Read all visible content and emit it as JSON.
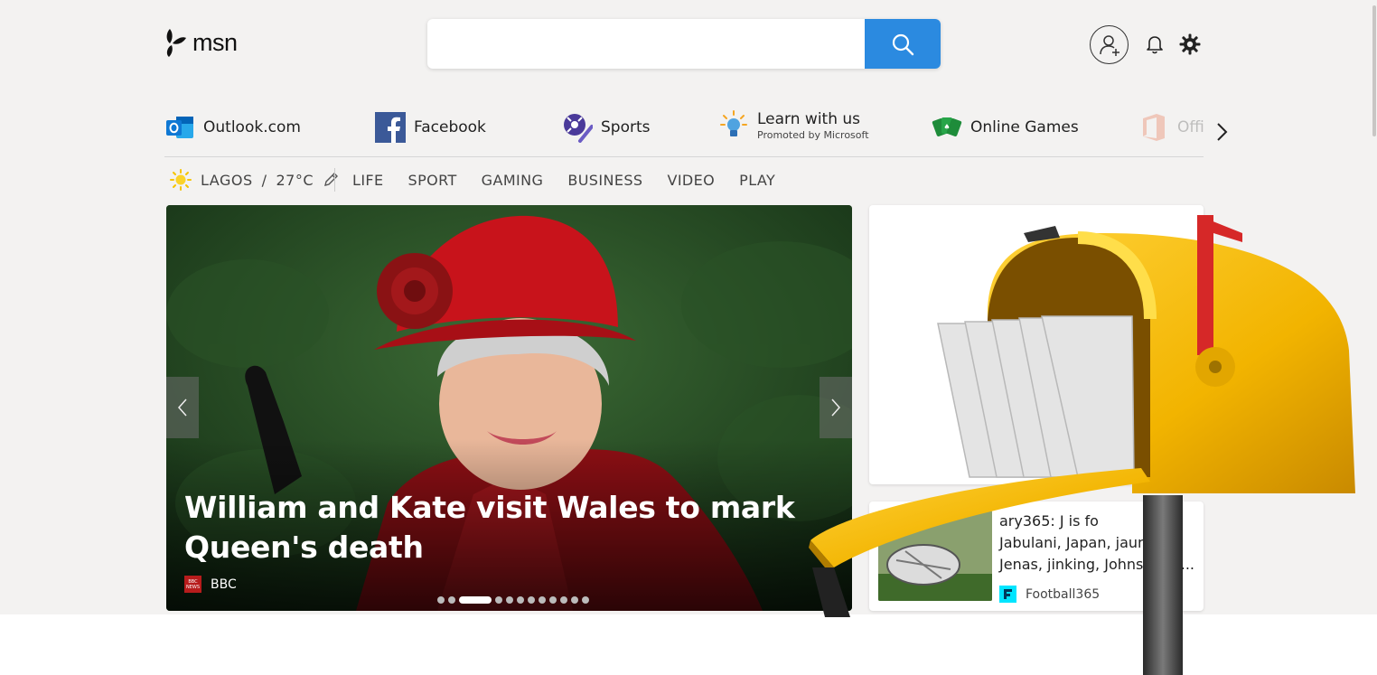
{
  "header": {
    "logo_text": "msn",
    "search": {
      "value": "",
      "placeholder": ""
    }
  },
  "quick_links": [
    {
      "label": "Outlook.com",
      "icon": "outlook-icon",
      "sub": ""
    },
    {
      "label": "Facebook",
      "icon": "facebook-icon",
      "sub": ""
    },
    {
      "label": "Sports",
      "icon": "sports-icon",
      "sub": ""
    },
    {
      "label": "Learn with us",
      "icon": "lightbulb-icon",
      "sub": "Promoted by Microsoft"
    },
    {
      "label": "Online Games",
      "icon": "cards-icon",
      "sub": ""
    },
    {
      "label": "Offi",
      "icon": "office-icon",
      "sub": ""
    }
  ],
  "weather": {
    "location": "LAGOS",
    "temp": "27°C"
  },
  "nav": [
    "LIFE",
    "SPORT",
    "GAMING",
    "BUSINESS",
    "VIDEO",
    "PLAY"
  ],
  "hero": {
    "headline": "William and Kate visit Wales to mark Queen's death",
    "source": "BBC",
    "source_badge": "BBC NEWS",
    "slide_count": 12,
    "active_slide": 3
  },
  "news_card": {
    "title_fragment": "ary365: J is fo",
    "title_lines": [
      "Jabulani, Japan, jaun",
      "Jenas, jinking, Johnst"
    ],
    "ellipsis": "...",
    "source": "Football365"
  },
  "colors": {
    "page_bg": "#f3f2f1",
    "search_button": "#2b8ae0",
    "mailbox_yellow": "#f5b800",
    "flag_red": "#d62828"
  }
}
